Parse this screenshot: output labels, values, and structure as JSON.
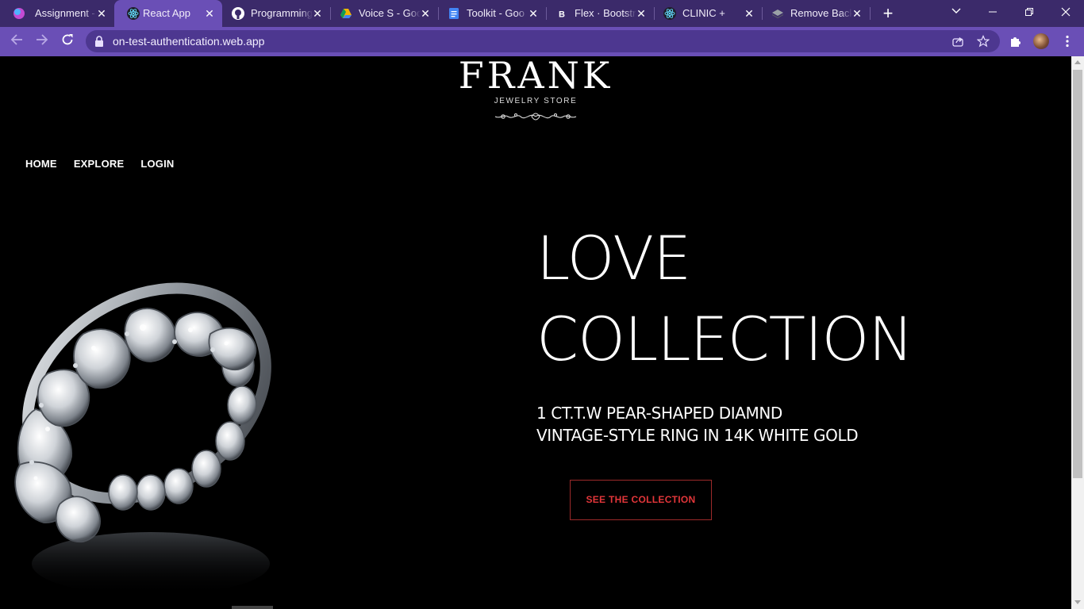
{
  "browser": {
    "tabs": [
      {
        "title": "Assignment -",
        "active": false,
        "favicon": "gradient-circle-icon"
      },
      {
        "title": "React App",
        "active": true,
        "favicon": "react-icon"
      },
      {
        "title": "Programming",
        "active": false,
        "favicon": "github-icon"
      },
      {
        "title": "Voice S - Goo",
        "active": false,
        "favicon": "drive-icon"
      },
      {
        "title": "Toolkit - Goo",
        "active": false,
        "favicon": "docs-icon"
      },
      {
        "title": "Flex · Bootstra",
        "active": false,
        "favicon": "bootstrap-icon"
      },
      {
        "title": "CLINIC +",
        "active": false,
        "favicon": "react-icon"
      },
      {
        "title": "Remove Backg",
        "active": false,
        "favicon": "removebg-icon"
      }
    ],
    "url": "on-test-authentication.web.app",
    "colors": {
      "chrome_dark": "#3b2a6a",
      "chrome_accent": "#6a4fb6"
    }
  },
  "site": {
    "logo": {
      "brand": "FRANK",
      "tagline": "JEWELRY STORE"
    },
    "nav": [
      "HOME",
      "EXPLORE",
      "LOGIN"
    ],
    "hero": {
      "title_line1": "LOVE",
      "title_line2": "COLLECTION",
      "subtitle_line1": "1 CT.T.W PEAR-SHAPED DIAMND",
      "subtitle_line2": "VINTAGE-STYLE RING IN 14K WHITE GOLD",
      "cta": "SEE THE COLLECTION"
    },
    "colors": {
      "background": "#000000",
      "text": "#ffffff",
      "cta": "#e2363a",
      "cta_border": "#9c2a2a"
    }
  }
}
